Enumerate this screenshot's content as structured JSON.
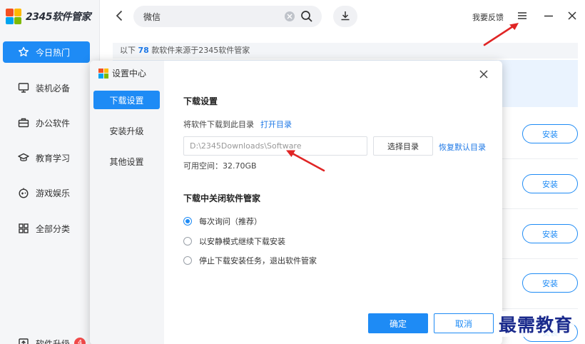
{
  "app": {
    "logo_text": "2345软件管家",
    "colors": {
      "accent": "#1e8bf5",
      "logo": [
        "#f25022",
        "#ffb900",
        "#00a4ef",
        "#7fba00"
      ]
    }
  },
  "sidebar": {
    "items": [
      {
        "label": "今日热门",
        "icon": "star-icon",
        "active": true
      },
      {
        "label": "装机必备",
        "icon": "monitor-icon"
      },
      {
        "label": "办公软件",
        "icon": "briefcase-icon"
      },
      {
        "label": "教育学习",
        "icon": "graduation-cap-icon"
      },
      {
        "label": "游戏娱乐",
        "icon": "gamepad-icon"
      },
      {
        "label": "全部分类",
        "icon": "grid-icon"
      }
    ],
    "upgrade": {
      "label": "软件升级",
      "badge": "4"
    }
  },
  "topbar": {
    "search_value": "微信",
    "feedback": "我要反馈"
  },
  "list": {
    "count_prefix": "以下",
    "count": "78",
    "count_suffix": "款软件来源于2345软件管家",
    "install_label": "安装"
  },
  "dialog": {
    "title": "设置中心",
    "tabs": [
      "下载设置",
      "安装升级",
      "其他设置"
    ],
    "download_section": {
      "title": "下载设置",
      "dir_label": "将软件下载到此目录",
      "open_dir": "打开目录",
      "path_value": "D:\\2345Downloads\\Software",
      "choose_dir": "选择目录",
      "restore_default": "恢复默认目录",
      "free_space": "可用空间：32.70GB"
    },
    "close_section": {
      "title": "下载中关闭软件管家",
      "options": [
        "每次询问（推荐）",
        "以安静模式继续下载安装",
        "停止下载安装任务，退出软件管家"
      ],
      "selected": 0
    },
    "ok": "确定",
    "cancel": "取消"
  },
  "watermark": "最需教育"
}
